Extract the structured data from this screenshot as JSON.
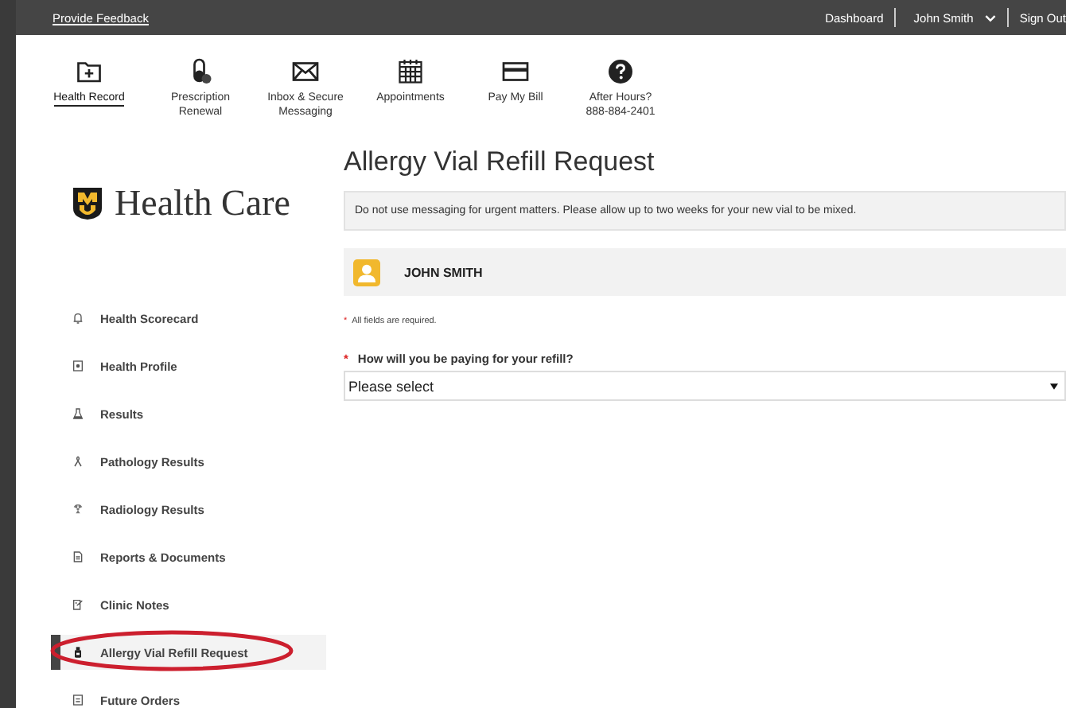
{
  "top_bar": {
    "feedback_link": "Provide Feedback",
    "links": [
      {
        "label": "Dashboard",
        "kind": "link"
      },
      {
        "label": "John Smith",
        "kind": "user"
      },
      {
        "label": "Sign Out",
        "kind": "link"
      }
    ]
  },
  "nav": [
    {
      "label": "Health Record",
      "kind": "folder",
      "selected": true
    },
    {
      "label": "Prescription\nRenewal",
      "kind": "pill",
      "selected": false
    },
    {
      "label": "Inbox & Secure\nMessaging",
      "kind": "envelope",
      "selected": false
    },
    {
      "label": "Appointments",
      "kind": "calendar",
      "selected": false
    },
    {
      "label": "Pay My Bill",
      "kind": "card",
      "selected": false
    },
    {
      "label": "After Hours?\n888-884-2401",
      "kind": "question",
      "selected": false
    }
  ],
  "logo": {
    "text": "Health Care"
  },
  "sidebar": {
    "items": [
      {
        "label": "Health Scorecard",
        "kind": "bell",
        "selected": false
      },
      {
        "label": "Health Profile",
        "kind": "profile",
        "selected": false
      },
      {
        "label": "Results",
        "kind": "flask",
        "selected": false
      },
      {
        "label": "Pathology Results",
        "kind": "ribbon",
        "selected": false
      },
      {
        "label": "Radiology Results",
        "kind": "radiation",
        "selected": false
      },
      {
        "label": "Reports & Documents",
        "kind": "document",
        "selected": false
      },
      {
        "label": "Clinic Notes",
        "kind": "notes",
        "selected": false
      },
      {
        "label": "Allergy Vial Refill Request",
        "kind": "vial",
        "selected": true
      },
      {
        "label": "Future Orders",
        "kind": "orders",
        "selected": false
      }
    ]
  },
  "page": {
    "title": "Allergy Vial Refill Request",
    "notice": "Do not use messaging for urgent matters. Please allow up to two weeks for your new vial to be mixed.",
    "patient": "JOHN SMITH",
    "required_note": {
      "mark": "*",
      "text": "All fields are required."
    },
    "question": {
      "mark": "*",
      "text": "How will you be paying for your refill?"
    },
    "select": {
      "value": "Please select"
    }
  }
}
